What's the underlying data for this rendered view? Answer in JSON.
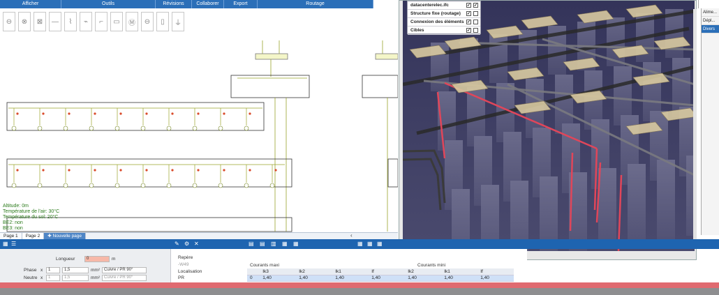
{
  "ribbon": {
    "groups": [
      {
        "label": "Afficher",
        "width": 88
      },
      {
        "label": "Outils",
        "width": 135
      },
      {
        "label": "Révisions",
        "width": 52
      },
      {
        "label": "Collaborer",
        "width": 46
      },
      {
        "label": "Export",
        "width": 48
      },
      {
        "label": "Routage",
        "width": 166
      }
    ]
  },
  "viewer": {
    "layers": [
      {
        "name": "datacenterelec.ifc",
        "checked1": true,
        "checked2": true
      },
      {
        "name": "Structure fixe (routage)",
        "checked1": true,
        "checked2": false
      },
      {
        "name": "Connexion des éléments",
        "checked1": true,
        "checked2": false
      },
      {
        "name": "Cibles",
        "checked1": true,
        "checked2": false
      }
    ]
  },
  "right_panel": {
    "items": [
      {
        "label": "Alime..."
      },
      {
        "label": "Dépl..."
      },
      {
        "label": "Divers",
        "active": true
      }
    ]
  },
  "schematic": {
    "info": [
      "Altitude: 0m",
      "Température de l'air: 30°C",
      "Température du sol: 20°C",
      "BE2: non",
      "BE3: non"
    ]
  },
  "page_tabs": [
    {
      "label": "Page 1"
    },
    {
      "label": "Page 2",
      "active": true
    },
    {
      "label": "Nouvelle page",
      "new": true
    }
  ],
  "props": {
    "longueur_label": "Longueur",
    "longueur_value": "0",
    "longueur_unit": "m",
    "phase_label": "Phase",
    "neutre_label": "Neutre",
    "x": "x",
    "count": "1",
    "section": "1,5",
    "section_unit": "mm²",
    "material": "Cuivre / PR 90°"
  },
  "repere": {
    "label": "Repère",
    "value": "-W49",
    "localization_label": "Localisation",
    "localization_value": "PR"
  },
  "currents": {
    "maxi_label": "Courants maxi",
    "mini_label": "Courants mini",
    "headers": [
      "",
      "Ik3",
      "Ik2",
      "Ik1",
      "If",
      "Ik2",
      "Ik1",
      "If"
    ],
    "row": [
      "0",
      "1,40",
      "1,40",
      "1,40",
      "1,40",
      "1,40",
      "1,40",
      "1,40"
    ]
  }
}
